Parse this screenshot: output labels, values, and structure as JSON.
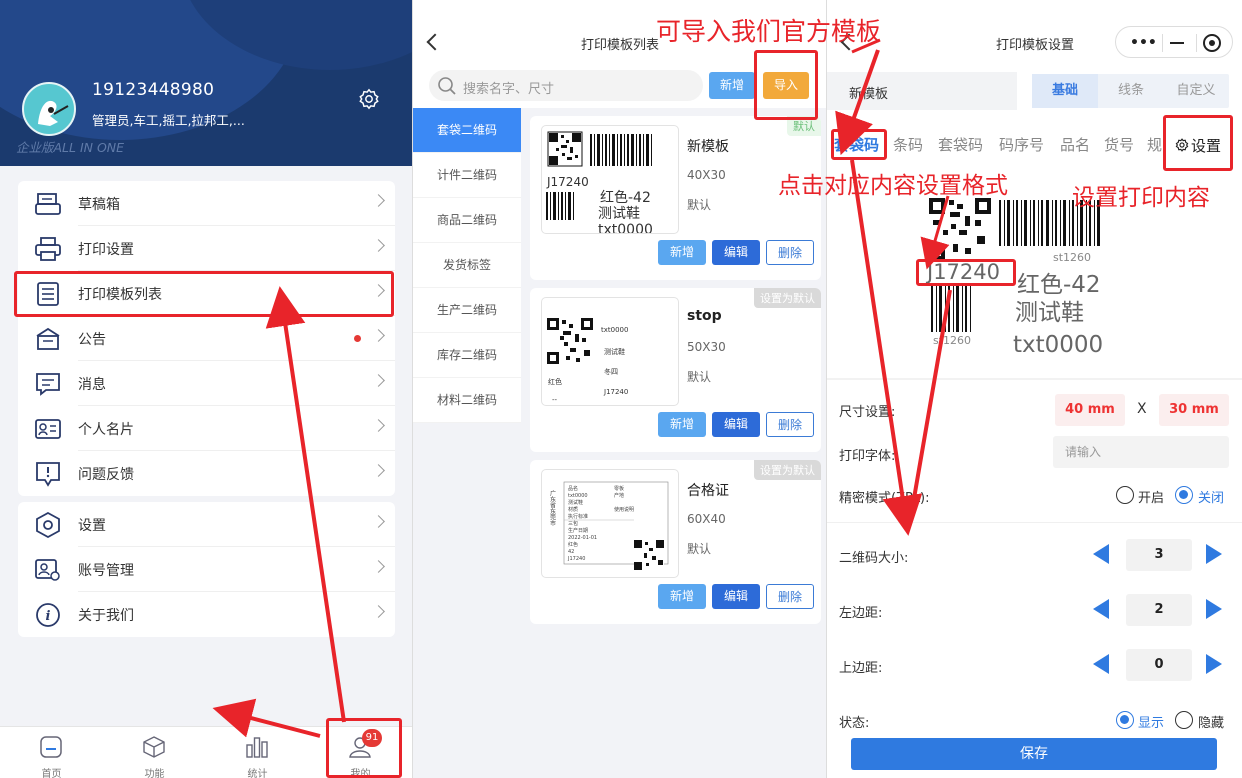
{
  "profile": {
    "phone": "19123448980",
    "roles": "管理员,车工,摇工,拉邦工,...",
    "edition": "企业版ALL IN ONE"
  },
  "menu_group1": [
    {
      "label": "草稿箱",
      "icon": "drafts-icon"
    },
    {
      "label": "打印设置",
      "icon": "printer-icon"
    },
    {
      "label": "打印模板列表",
      "icon": "template-list-icon"
    },
    {
      "label": "公告",
      "icon": "announcement-icon"
    },
    {
      "label": "消息",
      "icon": "message-icon"
    },
    {
      "label": "个人名片",
      "icon": "business-card-icon"
    },
    {
      "label": "问题反馈",
      "icon": "feedback-icon"
    }
  ],
  "menu_group2": [
    {
      "label": "设置",
      "icon": "settings-icon"
    },
    {
      "label": "账号管理",
      "icon": "account-icon"
    },
    {
      "label": "关于我们",
      "icon": "info-icon"
    }
  ],
  "tabbar": [
    {
      "label": "首页",
      "icon": "home-icon"
    },
    {
      "label": "功能",
      "icon": "cube-icon"
    },
    {
      "label": "统计",
      "icon": "stats-icon"
    },
    {
      "label": "我的",
      "icon": "user-icon"
    }
  ],
  "badge": "91",
  "template_list": {
    "title": "打印模板列表",
    "search_placeholder": "搜索名字、尺寸",
    "add_label": "新增",
    "import_label": "导入",
    "categories": [
      "套袋二维码",
      "计件二维码",
      "商品二维码",
      "发货标签",
      "生产二维码",
      "库存二维码",
      "材料二维码"
    ],
    "templates": [
      {
        "name": "新模板",
        "size": "40X30",
        "default": "默认",
        "tag": "默认"
      },
      {
        "name": "stop",
        "size": "50X30",
        "default": "默认",
        "tag": "设置为默认"
      },
      {
        "name": "合格证",
        "size": "60X40",
        "default": "默认",
        "tag": "设置为默认"
      }
    ],
    "btn_add": "新增",
    "btn_edit": "编辑",
    "btn_delete": "删除",
    "previews": {
      "t1": {
        "code": "J17240",
        "color": "红色-42",
        "shoe": "测试鞋",
        "txt": "txt0000"
      },
      "t2": {
        "txt": "txt0000",
        "shoe": "测试鞋",
        "color": "红色",
        "season": "冬四",
        "code": "J17240",
        "dash": "--"
      },
      "t3": {
        "lines": [
          "品名",
          "txt0000",
          "测试鞋",
          "材质",
          "执行标准",
          "三包",
          "生产日期",
          "2022-01-01",
          "红色",
          "42",
          "J17240"
        ],
        "right_lines": [
          "零板",
          "产地",
          "",
          "使用说明"
        ],
        "vert": "广东省东莞市"
      }
    }
  },
  "settings": {
    "title": "打印模板设置",
    "template_name": "新模板",
    "segments": [
      "基础",
      "线条",
      "自定义"
    ],
    "fields": [
      "套袋码",
      "条码",
      "套袋码",
      "码序号",
      "品名",
      "货号",
      "规"
    ],
    "set_label": "设置",
    "preview": {
      "code": "J17240",
      "color": "红色-42",
      "shoe": "测试鞋",
      "txt": "txt0000",
      "barcode_text": "st1260"
    },
    "size_label": "尺寸设置:",
    "width": "40 mm",
    "x": "X",
    "height": "30 mm",
    "font_label": "打印字体:",
    "font_placeholder": "请输入",
    "mode_label": "精密模式(ZPL):",
    "mode_on": "开启",
    "mode_off": "关闭",
    "qr_size_label": "二维码大小:",
    "qr_size": "3",
    "left_margin_label": "左边距:",
    "left_margin": "2",
    "top_margin_label": "上边距:",
    "top_margin": "0",
    "status_label": "状态:",
    "status_show": "显示",
    "status_hide": "隐藏",
    "save_label": "保存"
  },
  "annotations": {
    "import": "可导入我们官方模板",
    "click_field": "点击对应内容设置格式",
    "set_content": "设置打印内容"
  },
  "colors": {
    "brand_blue": "#2f7ae0",
    "annotation_red": "#e8242a",
    "header_navy": "#1b3a6e",
    "import_orange": "#f2a93b"
  }
}
